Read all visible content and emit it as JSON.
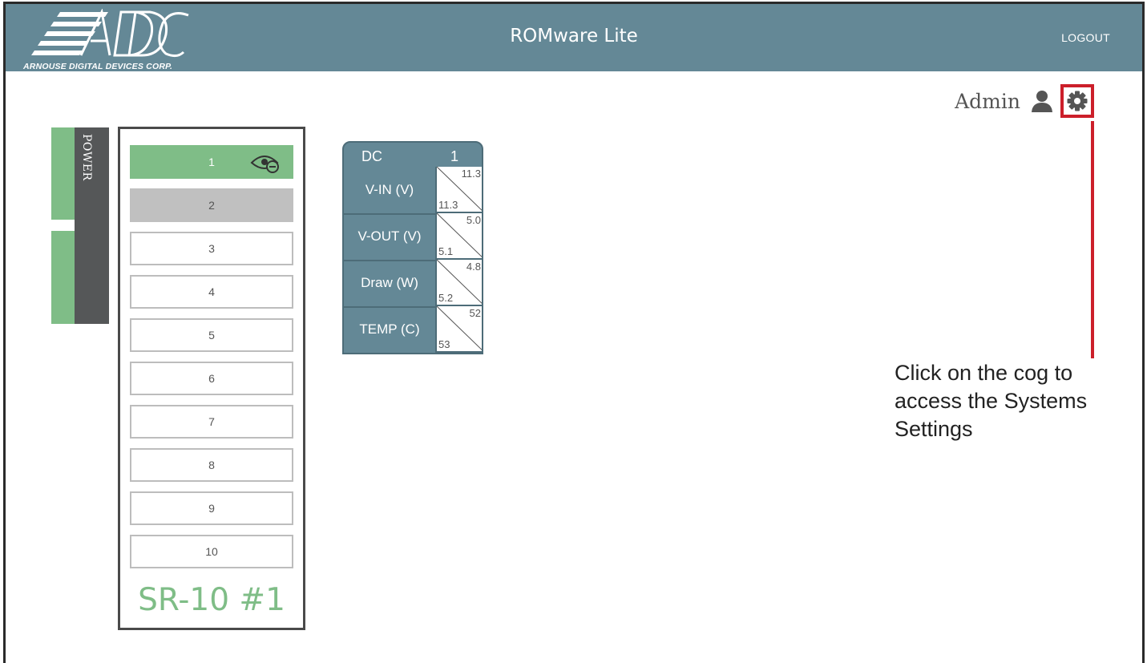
{
  "header": {
    "logo_text": "ADDC",
    "logo_subtitle": "ARNOUSE DIGITAL DEVICES CORP.",
    "title": "ROMware Lite",
    "logout_label": "LOGOUT"
  },
  "user": {
    "name": "Admin",
    "user_icon": "user-icon",
    "settings_icon": "gear-icon"
  },
  "annotation": {
    "text": "Click on the cog to access the Systems Settings",
    "color": "#cc1f2a"
  },
  "power": {
    "label": "POWER"
  },
  "chassis": {
    "name": "SR-10 #1",
    "slots": [
      {
        "label": "1",
        "state": "active",
        "icon": "eye-icon"
      },
      {
        "label": "2",
        "state": "empty"
      },
      {
        "label": "3",
        "state": "available"
      },
      {
        "label": "4",
        "state": "available"
      },
      {
        "label": "5",
        "state": "available"
      },
      {
        "label": "6",
        "state": "available"
      },
      {
        "label": "7",
        "state": "available"
      },
      {
        "label": "8",
        "state": "available"
      },
      {
        "label": "9",
        "state": "available"
      },
      {
        "label": "10",
        "state": "available"
      }
    ]
  },
  "dc_panel": {
    "title": "DC",
    "unit": "1",
    "rows": [
      {
        "label": "V-IN (V)",
        "top": "11.3",
        "bottom": "11.3"
      },
      {
        "label": "V-OUT (V)",
        "top": "5.0",
        "bottom": "5.1"
      },
      {
        "label": "Draw (W)",
        "top": "4.8",
        "bottom": "5.2"
      },
      {
        "label": "TEMP (C)",
        "top": "52",
        "bottom": "53"
      }
    ]
  },
  "colors": {
    "header_bg": "#648896",
    "active_green": "#7fbd87",
    "power_dark": "#555758",
    "highlight_red": "#cc1f2a"
  }
}
